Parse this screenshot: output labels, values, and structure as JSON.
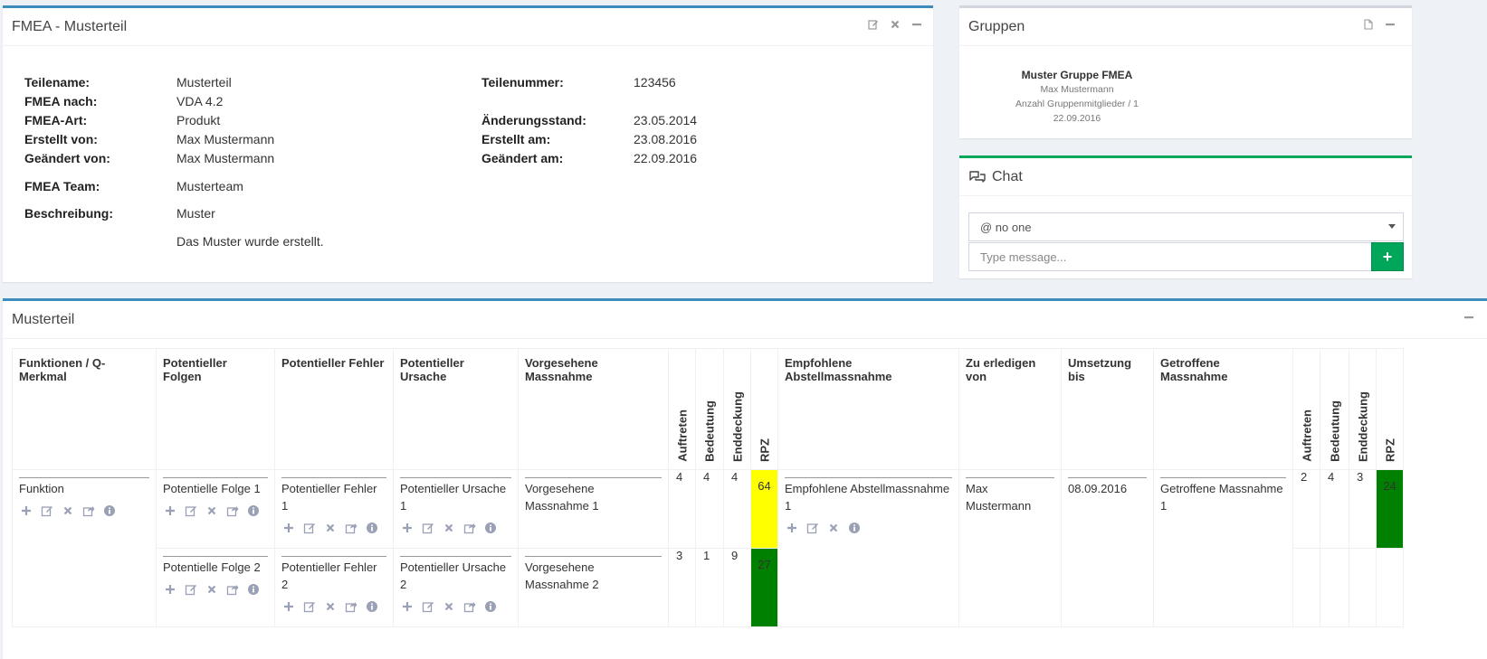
{
  "fmea_panel": {
    "title": "FMEA - Musterteil",
    "left": [
      {
        "label": "Teilename:",
        "value": "Musterteil"
      },
      {
        "label": "FMEA nach:",
        "value": "VDA 4.2"
      },
      {
        "label": "FMEA-Art:",
        "value": "Produkt"
      },
      {
        "label": "Erstellt von:",
        "value": "Max Mustermann"
      },
      {
        "label": "Geändert von:",
        "value": "Max Mustermann"
      },
      {
        "label": "FMEA Team:",
        "value": "Musterteam"
      },
      {
        "label": "Beschreibung:",
        "value": "Muster"
      }
    ],
    "description_extra": "Das Muster wurde erstellt.",
    "right": [
      {
        "label": "Teilenummer:",
        "value": "123456"
      },
      {
        "label": "Änderungsstand:",
        "value": "23.05.2014"
      },
      {
        "label": "Erstellt am:",
        "value": "23.08.2016"
      },
      {
        "label": "Geändert am:",
        "value": "22.09.2016"
      }
    ]
  },
  "gruppen_panel": {
    "title": "Gruppen",
    "group": {
      "name": "Muster Gruppe FMEA",
      "owner": "Max Mustermann",
      "members": "Anzahl Gruppenmitglieder / 1",
      "date": "22.09.2016"
    }
  },
  "chat_panel": {
    "title": "Chat",
    "recipient": "@ no one",
    "placeholder": "Type message...",
    "send_label": "+"
  },
  "muster_panel": {
    "title": "Musterteil",
    "headers": {
      "funktionen": "Funktionen / Q-Merkmal",
      "folgen": "Potentieller Folgen",
      "fehler": "Potentieller Fehler",
      "ursache": "Potentieller Ursache",
      "vorgesehene": "Vorgesehene Massnahme",
      "auftreten": "Auftreten",
      "bedeutung": "Bedeutung",
      "enddeckung": "Enddeckung",
      "rpz": "RPZ",
      "empfohlene": "Empfohlene Abstellmassnahme",
      "zu_erledigen": "Zu erledigen von",
      "umsetzung": "Umsetzung bis",
      "getroffene": "Getroffene Massnahme",
      "auftreten2": "Auftreten",
      "bedeutung2": "Bedeutung",
      "enddeckung2": "Enddeckung",
      "rpz2": "RPZ"
    },
    "funktion": "Funktion",
    "rows": [
      {
        "folge": "Potentielle Folge 1",
        "fehler": "Potentieller Fehler 1",
        "ursache": "Potentieller Ursache 1",
        "vorgesehene": "Vorgesehene Massnahme 1",
        "auftreten": "4",
        "bedeutung": "4",
        "enddeckung": "4",
        "rpz": "64",
        "rpz_color": "#ffff00",
        "empfohlene": "Empfohlene Abstellmassnahme 1",
        "zu_erledigen": "Max Mustermann",
        "umsetzung": "08.09.2016",
        "getroffene": "Getroffene Massnahme 1",
        "auftreten2": "2",
        "bedeutung2": "4",
        "enddeckung2": "3",
        "rpz2": "24",
        "rpz2_color": "#008000"
      },
      {
        "folge": "Potentielle Folge 2",
        "fehler": "Potentieller Fehler 2",
        "ursache": "Potentieller Ursache 2",
        "vorgesehene": "Vorgesehene Massnahme 2",
        "auftreten": "3",
        "bedeutung": "1",
        "enddeckung": "9",
        "rpz": "27",
        "rpz_color": "#008000"
      }
    ]
  },
  "colors": {
    "primary_border": "#3c8dbc",
    "chat_border": "#00a65a",
    "rpz_yellow": "#ffff00",
    "rpz_green": "#008000"
  }
}
